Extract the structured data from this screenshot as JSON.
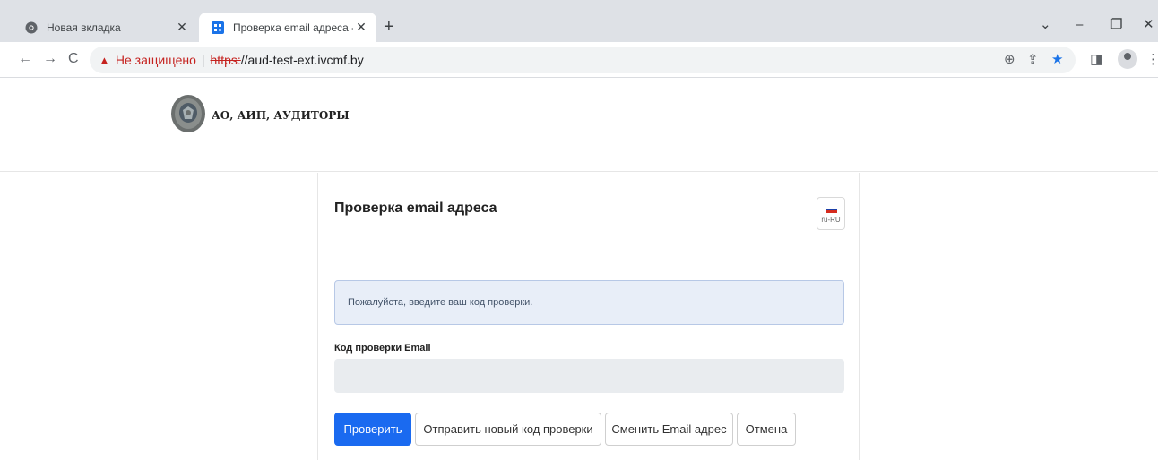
{
  "browser": {
    "tabs": [
      {
        "title": "Новая вкладка",
        "active": false
      },
      {
        "title": "Проверка email адреса - Audito",
        "active": true
      }
    ],
    "address": {
      "security_label": "Не защищено",
      "protocol": "https:",
      "rest": "//aud-test-ext.ivcmf.by"
    }
  },
  "header": {
    "brand": "АО, АИП, АУДИТОРЫ"
  },
  "card": {
    "title": "Проверка email адреса",
    "language": "ru-RU",
    "alert": "Пожалуйста, введите ваш код проверки.",
    "field_label": "Код проверки Email",
    "field_value": "",
    "buttons": {
      "verify": "Проверить",
      "resend": "Отправить новый код проверки",
      "change": "Сменить Email адрес",
      "cancel": "Отмена"
    }
  },
  "colors": {
    "primary": "#1a6af0",
    "alert_bg": "#e8eef8",
    "warning": "#c5221f"
  },
  "icons": [
    "chrome-icon",
    "site-favicon-icon",
    "close-icon",
    "plus-icon",
    "chevron-down-icon",
    "minimize-icon",
    "restore-icon",
    "back-icon",
    "forward-icon",
    "reload-icon",
    "warning-icon",
    "zoom-icon",
    "share-icon",
    "star-icon",
    "sidepanel-icon",
    "profile-icon",
    "menu-icon"
  ]
}
